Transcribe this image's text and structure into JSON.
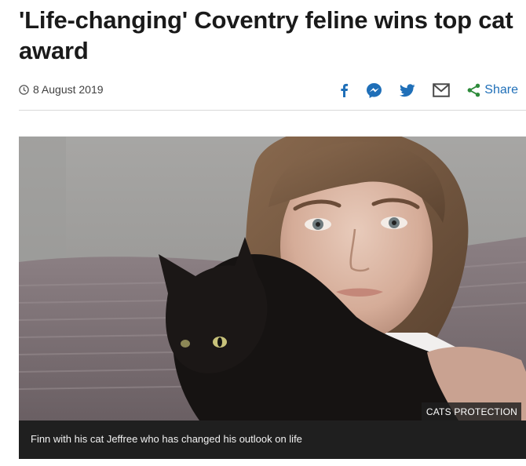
{
  "article": {
    "headline": "'Life-changing' Coventry feline wins top cat award",
    "date": "8 August 2019"
  },
  "share": {
    "facebook_icon": "facebook-icon",
    "messenger_icon": "messenger-icon",
    "twitter_icon": "twitter-icon",
    "email_icon": "email-icon",
    "share_icon": "share-icon",
    "share_label": "Share",
    "accent_color": "#1f6fb8"
  },
  "image": {
    "credit": "CATS PROTECTION",
    "caption": "Finn with his cat Jeffree who has changed his outlook on life"
  }
}
